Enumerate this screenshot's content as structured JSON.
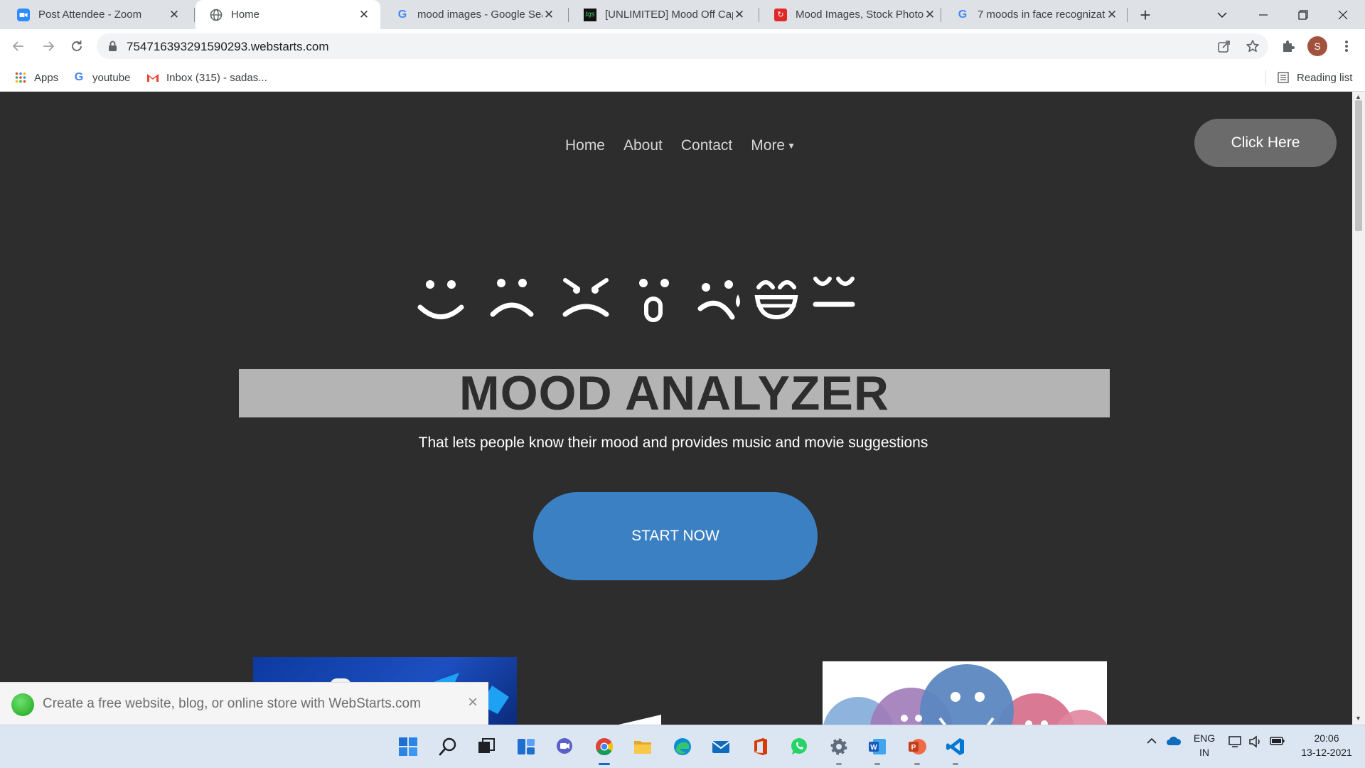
{
  "browser": {
    "tabs": [
      {
        "title": "Post Attendee - Zoom",
        "icon": "zoom-icon"
      },
      {
        "title": "Home",
        "icon": "globe-icon",
        "active": true
      },
      {
        "title": "mood images - Google Sea",
        "icon": "google-icon"
      },
      {
        "title": "[UNLIMITED] Mood Off Cap",
        "icon": "tqs-icon"
      },
      {
        "title": "Mood Images, Stock Photo",
        "icon": "stock-photo-icon"
      },
      {
        "title": "7 moods in face recognizat",
        "icon": "google-icon"
      }
    ],
    "url": "754716393291590293.webstarts.com",
    "profile_initial": "S",
    "bookmarks": {
      "apps": "Apps",
      "youtube": "youtube",
      "inbox": "Inbox (315) - sadas...",
      "reading_list": "Reading list"
    }
  },
  "site": {
    "nav": {
      "home": "Home",
      "about": "About",
      "contact": "Contact",
      "more": "More"
    },
    "cta_top": "Click Here",
    "title": "MOOD ANALYZER",
    "tagline": "That lets people know their mood and provides music and movie suggestions",
    "start_button": "START NOW",
    "face_icons": [
      "happy-face-icon",
      "sad-face-icon",
      "angry-face-icon",
      "surprised-face-icon",
      "crying-face-icon",
      "laughing-face-icon",
      "sleepy-face-icon"
    ],
    "promo": {
      "text": "Create a free website, blog, or online store with WebStarts.com"
    }
  },
  "taskbar": {
    "apps": [
      "start-icon",
      "search-icon",
      "task-view-icon",
      "widgets-icon",
      "teams-chat-icon",
      "chrome-icon",
      "file-explorer-icon",
      "edge-icon",
      "mail-icon",
      "office-icon",
      "whatsapp-icon",
      "settings-icon",
      "word-icon",
      "powerpoint-icon",
      "vscode-icon"
    ],
    "lang_top": "ENG",
    "lang_bottom": "IN",
    "time": "20:06",
    "date": "13-12-2021"
  },
  "colors": {
    "page_bg": "#2d2d2d",
    "title_band": "#b4b4b4",
    "start_button": "#3c80c4",
    "click_here": "#6b6b6b"
  }
}
